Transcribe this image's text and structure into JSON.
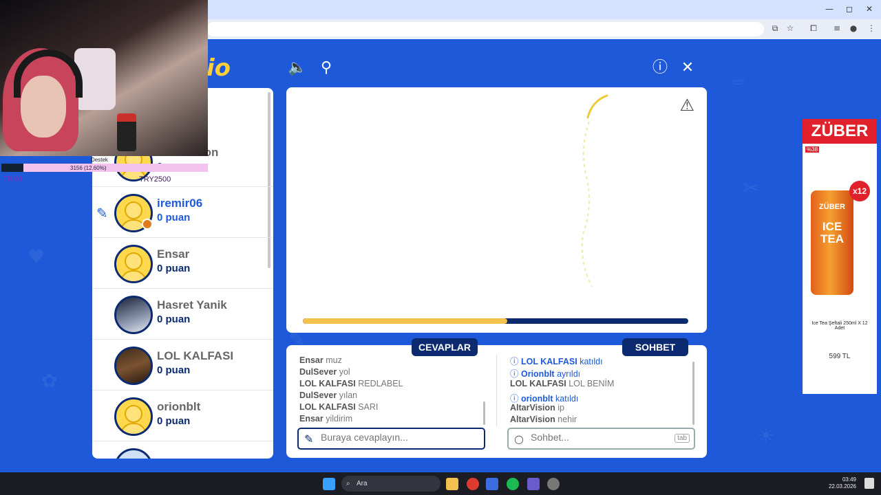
{
  "browser": {
    "window_controls": [
      "—",
      "◻",
      "✕"
    ]
  },
  "game": {
    "logo": "io",
    "answers_tab": "CEVAPLAR",
    "chat_tab": "SOHBET",
    "answer_placeholder": "Buraya cevaplayın...",
    "chat_placeholder": "Sohbet...",
    "tab_key": "tab",
    "timer_progress": 0.53,
    "players": [
      {
        "name": "AltarVision",
        "score": "0 puan"
      },
      {
        "name": "iremir06",
        "score": "0 puan"
      },
      {
        "name": "Ensar",
        "score": "0 puan"
      },
      {
        "name": "Hasret Yanik",
        "score": "0 puan"
      },
      {
        "name": "LOL KALFASI",
        "score": "0 puan"
      },
      {
        "name": "orionblt",
        "score": "0 puan"
      }
    ],
    "answers": [
      {
        "user": "Ensar",
        "text": "muz"
      },
      {
        "user": "DulSever",
        "text": "yol"
      },
      {
        "user": "LOL KALFASI",
        "text": "REDLABEL"
      },
      {
        "user": "DulSever",
        "text": "yılan"
      },
      {
        "user": "LOL KALFASI",
        "text": "SARI"
      },
      {
        "user": "Ensar",
        "text": "yildirim"
      }
    ],
    "chat": [
      {
        "user": "LOL KALFASI",
        "text": "katıldı",
        "system": true
      },
      {
        "user": "Orionblt",
        "text": "ayrıldı",
        "system": true
      },
      {
        "user": "LOL KALFASI",
        "text": "LOL BENİM",
        "system": false
      },
      {
        "user": "orionblt",
        "text": "katıldı",
        "system": true
      },
      {
        "user": "AltarVision",
        "text": "ip",
        "system": false
      },
      {
        "user": "AltarVision",
        "text": "nehir",
        "system": false
      }
    ],
    "colors": {
      "accent": "#0b2a6f",
      "background": "#1d59d8",
      "timer": "#f2c14e"
    }
  },
  "ad": {
    "brand": "ZÜBER",
    "discount": "%38",
    "badge": "x12",
    "can_brand": "ZÜBER",
    "can_text": "ICE TEA",
    "description": "Ice Tea Şeftali 250ml X 12 Adet",
    "price": "599 TL"
  },
  "stream_overlay": {
    "goal_label": "Destek",
    "progress_text": "3156 (12.60%)",
    "left_amount": "TRY0",
    "right_amount": "TRY2500"
  },
  "taskbar": {
    "search": "Ara",
    "time": "03:49",
    "date": "22.03.2026"
  }
}
